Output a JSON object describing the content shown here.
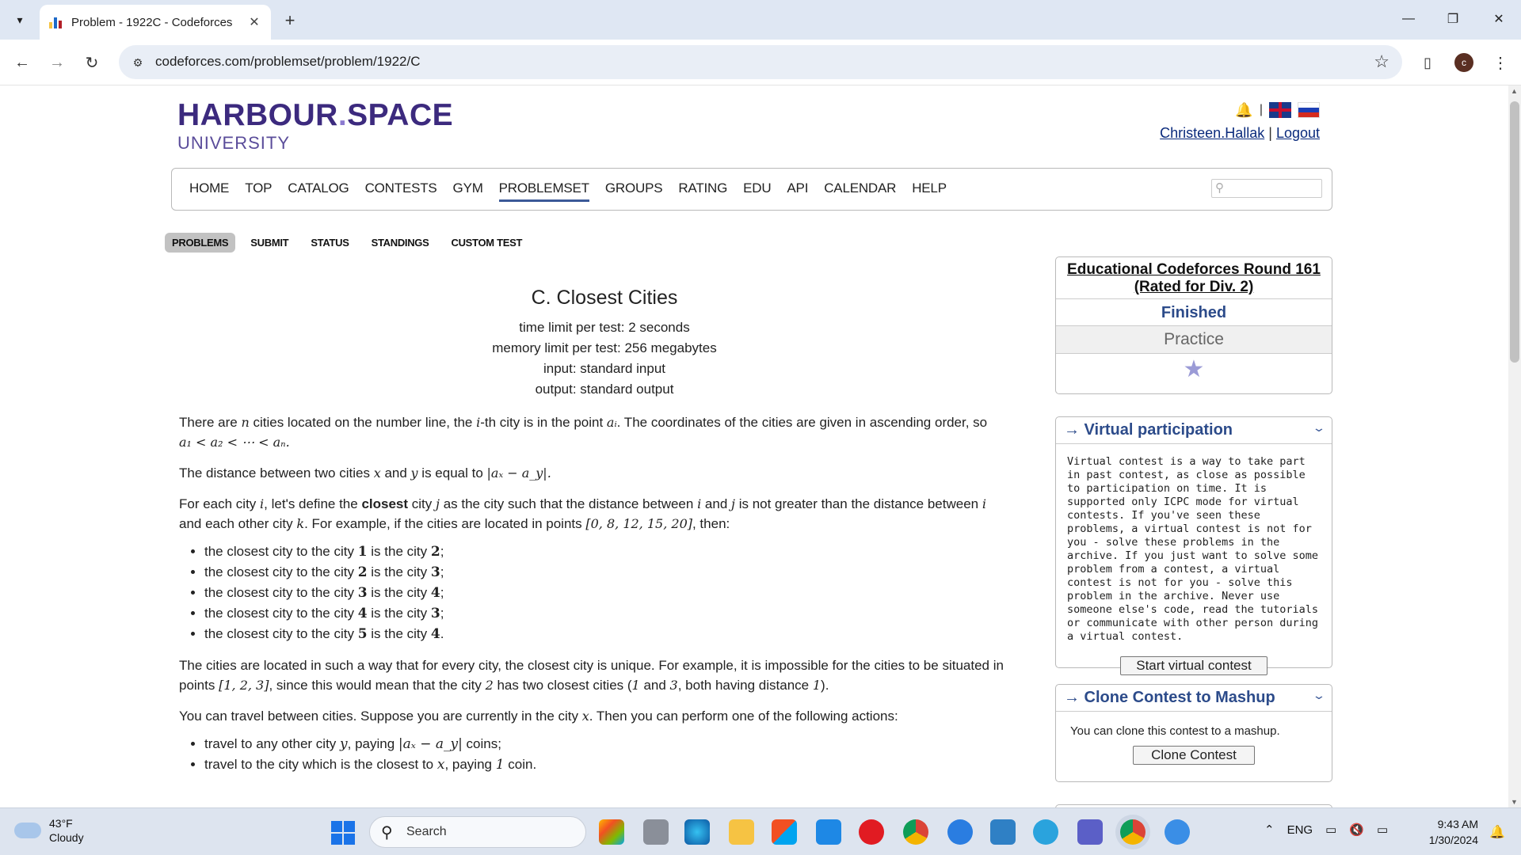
{
  "browser": {
    "tab_title": "Problem - 1922C - Codeforces",
    "url": "codeforces.com/problemset/problem/1922/C",
    "profile_initial": "c"
  },
  "site": {
    "logo_main": "HARBOUR",
    "logo_dot": ".",
    "logo_main2": "SPACE",
    "logo_sub": "UNIVERSITY",
    "user": "Christeen.Hallak",
    "separator": "|",
    "logout": "Logout",
    "menu": [
      "HOME",
      "TOP",
      "CATALOG",
      "CONTESTS",
      "GYM",
      "PROBLEMSET",
      "GROUPS",
      "RATING",
      "EDU",
      "API",
      "CALENDAR",
      "HELP"
    ],
    "active_menu": "PROBLEMSET",
    "subnav": [
      "PROBLEMS",
      "SUBMIT",
      "STATUS",
      "STANDINGS",
      "CUSTOM TEST"
    ]
  },
  "problem": {
    "title": "C. Closest Cities",
    "limits": [
      "time limit per test: 2 seconds",
      "memory limit per test: 256 megabytes",
      "input: standard input",
      "output: standard output"
    ],
    "p1a": "There are ",
    "p1b": " cities located on the number line, the ",
    "p1c": "-th city is in the point ",
    "p1d": ". The coordinates of the cities are given in ascending order, so",
    "p1math": "a₁ < a₂ < ⋯ < aₙ.",
    "p2a": "The distance between two cities ",
    "p2b": " and ",
    "p2c": " is equal to ",
    "p2math": "|aₓ − a_y|.",
    "p3a": "For each city ",
    "p3b": ", let's define the ",
    "p3bold": "closest",
    "p3c": " city ",
    "p3d": " as the city such that the distance between ",
    "p3e": " and ",
    "p3f": " is not greater than the distance between ",
    "p3g": "and each other city ",
    "p3h": ". For example, if the cities are located in points ",
    "p3points": "[0, 8, 12, 15, 20]",
    "p3i": ", then:",
    "closest_list": [
      {
        "a": "1",
        "b": "2"
      },
      {
        "a": "2",
        "b": "3"
      },
      {
        "a": "3",
        "b": "4"
      },
      {
        "a": "4",
        "b": "3"
      },
      {
        "a": "5",
        "b": "4"
      }
    ],
    "closest_prefix": "the closest city to the city ",
    "closest_mid": " is the city ",
    "p4a": "The cities are located in such a way that for every city, the closest city is unique. For example, it is impossible for the cities to be situated in",
    "p4b": "points ",
    "p4points": "[1, 2, 3]",
    "p4c": ", since this would mean that the city ",
    "p4d": " has two closest cities (",
    "p4e": " and ",
    "p4f": ", both having distance ",
    "p4g": ").",
    "p5": "You can travel between cities. Suppose you are currently in the city ",
    "p5end": ". Then you can perform one of the following actions:",
    "actions": [
      {
        "a": "travel to any other city ",
        "m": "y",
        "b": ", paying ",
        "m2": "|aₓ − a_y|",
        "c": " coins;"
      },
      {
        "a": "travel to the city which is the closest to ",
        "m": "x",
        "b": ", paying ",
        "m2": "1",
        "c": " coin."
      }
    ],
    "vars": {
      "n": "n",
      "i": "i",
      "ai": "aᵢ",
      "x": "x",
      "y": "y",
      "j": "j",
      "k": "k",
      "two": "2",
      "one": "1",
      "three": "3"
    }
  },
  "sidebar": {
    "round_title": "Educational Codeforces Round 161 (Rated for Div. 2)",
    "round_status": "Finished",
    "round_mode": "Practice",
    "virtual_title": "→ Virtual participation",
    "virtual_text": "Virtual contest is a way to take part in past contest, as close as possible to participation on time. It is supported only ICPC mode for virtual contests. If you've seen these problems, a virtual contest is not for you - solve these problems in the archive. If you just want to solve some problem from a contest, a virtual contest is not for you - solve this problem in the archive. Never use someone else's code, read the tutorials or communicate with other person during a virtual contest.",
    "virtual_button": "Start virtual contest",
    "clone_title": "→ Clone Contest to Mashup",
    "clone_text": "You can clone this contest to a mashup.",
    "clone_button": "Clone Contest"
  },
  "taskbar": {
    "temp": "43°F",
    "condition": "Cloudy",
    "search": "Search",
    "lang": "ENG",
    "time": "9:43 AM",
    "date": "1/30/2024"
  },
  "colors": {
    "brand": "#3c2a7e",
    "link": "#2c4b8a",
    "accent": "#1a73e8"
  }
}
